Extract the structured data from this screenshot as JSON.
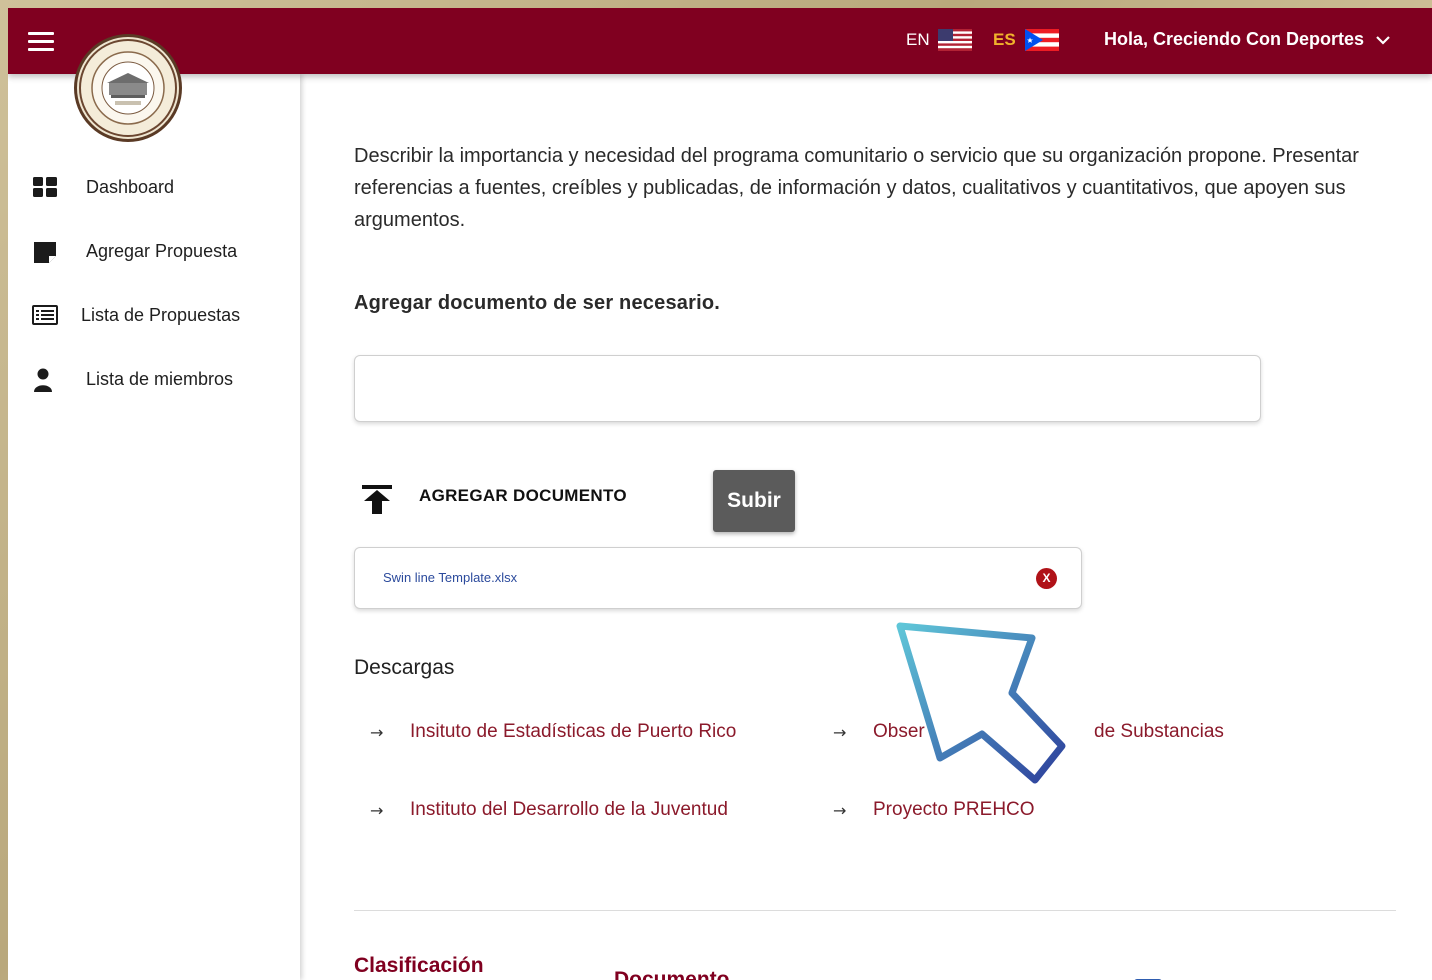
{
  "topbar": {
    "lang_en": "EN",
    "lang_es": "ES",
    "greeting": "Hola, Creciendo Con Deportes",
    "brand_color": "#800020",
    "es_color": "#f0b32c"
  },
  "sidebar": {
    "items": [
      {
        "label": "Dashboard",
        "icon": "dashboard-icon"
      },
      {
        "label": "Agregar Propuesta",
        "icon": "note-icon"
      },
      {
        "label": "Lista de Propuestas",
        "icon": "list-icon"
      },
      {
        "label": "Lista de miembros",
        "icon": "user-icon"
      }
    ]
  },
  "main": {
    "description": "Describir la importancia y necesidad del programa comunitario o servicio que su organización propone. Presentar referencias a fuentes, creíbles y publicadas, de información y datos, cualitativos y cuantitativos, que apoyen sus argumentos.",
    "document_heading": "Agregar documento de ser necesario.",
    "upload_label": "AGREGAR DOCUMENTO",
    "upload_button": "Subir",
    "file_name": "Swin line Template.xlsx",
    "file_remove": "X",
    "downloads_title": "Descargas",
    "downloads": [
      {
        "arrow": "→",
        "label": "Insituto de Estadísticas de Puerto Rico"
      },
      {
        "arrow": "→",
        "label": "Obser"
      },
      {
        "arrow": "",
        "label": "de Substancias"
      },
      {
        "arrow": "→",
        "label": "Instituto del Desarrollo de la Juventud"
      },
      {
        "arrow": "→",
        "label": "Proyecto PREHCO"
      }
    ],
    "footer_sections": [
      "Clasificación",
      "Documento"
    ]
  }
}
